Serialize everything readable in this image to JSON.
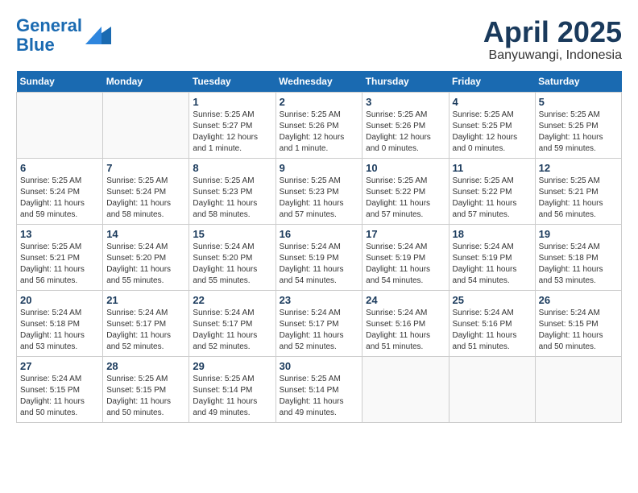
{
  "header": {
    "logo_line1": "General",
    "logo_line2": "Blue",
    "month": "April 2025",
    "location": "Banyuwangi, Indonesia"
  },
  "days_of_week": [
    "Sunday",
    "Monday",
    "Tuesday",
    "Wednesday",
    "Thursday",
    "Friday",
    "Saturday"
  ],
  "weeks": [
    [
      {
        "day": "",
        "content": ""
      },
      {
        "day": "",
        "content": ""
      },
      {
        "day": "1",
        "content": "Sunrise: 5:25 AM\nSunset: 5:27 PM\nDaylight: 12 hours and 1 minute."
      },
      {
        "day": "2",
        "content": "Sunrise: 5:25 AM\nSunset: 5:26 PM\nDaylight: 12 hours and 1 minute."
      },
      {
        "day": "3",
        "content": "Sunrise: 5:25 AM\nSunset: 5:26 PM\nDaylight: 12 hours and 0 minutes."
      },
      {
        "day": "4",
        "content": "Sunrise: 5:25 AM\nSunset: 5:25 PM\nDaylight: 12 hours and 0 minutes."
      },
      {
        "day": "5",
        "content": "Sunrise: 5:25 AM\nSunset: 5:25 PM\nDaylight: 11 hours and 59 minutes."
      }
    ],
    [
      {
        "day": "6",
        "content": "Sunrise: 5:25 AM\nSunset: 5:24 PM\nDaylight: 11 hours and 59 minutes."
      },
      {
        "day": "7",
        "content": "Sunrise: 5:25 AM\nSunset: 5:24 PM\nDaylight: 11 hours and 58 minutes."
      },
      {
        "day": "8",
        "content": "Sunrise: 5:25 AM\nSunset: 5:23 PM\nDaylight: 11 hours and 58 minutes."
      },
      {
        "day": "9",
        "content": "Sunrise: 5:25 AM\nSunset: 5:23 PM\nDaylight: 11 hours and 57 minutes."
      },
      {
        "day": "10",
        "content": "Sunrise: 5:25 AM\nSunset: 5:22 PM\nDaylight: 11 hours and 57 minutes."
      },
      {
        "day": "11",
        "content": "Sunrise: 5:25 AM\nSunset: 5:22 PM\nDaylight: 11 hours and 57 minutes."
      },
      {
        "day": "12",
        "content": "Sunrise: 5:25 AM\nSunset: 5:21 PM\nDaylight: 11 hours and 56 minutes."
      }
    ],
    [
      {
        "day": "13",
        "content": "Sunrise: 5:25 AM\nSunset: 5:21 PM\nDaylight: 11 hours and 56 minutes."
      },
      {
        "day": "14",
        "content": "Sunrise: 5:24 AM\nSunset: 5:20 PM\nDaylight: 11 hours and 55 minutes."
      },
      {
        "day": "15",
        "content": "Sunrise: 5:24 AM\nSunset: 5:20 PM\nDaylight: 11 hours and 55 minutes."
      },
      {
        "day": "16",
        "content": "Sunrise: 5:24 AM\nSunset: 5:19 PM\nDaylight: 11 hours and 54 minutes."
      },
      {
        "day": "17",
        "content": "Sunrise: 5:24 AM\nSunset: 5:19 PM\nDaylight: 11 hours and 54 minutes."
      },
      {
        "day": "18",
        "content": "Sunrise: 5:24 AM\nSunset: 5:19 PM\nDaylight: 11 hours and 54 minutes."
      },
      {
        "day": "19",
        "content": "Sunrise: 5:24 AM\nSunset: 5:18 PM\nDaylight: 11 hours and 53 minutes."
      }
    ],
    [
      {
        "day": "20",
        "content": "Sunrise: 5:24 AM\nSunset: 5:18 PM\nDaylight: 11 hours and 53 minutes."
      },
      {
        "day": "21",
        "content": "Sunrise: 5:24 AM\nSunset: 5:17 PM\nDaylight: 11 hours and 52 minutes."
      },
      {
        "day": "22",
        "content": "Sunrise: 5:24 AM\nSunset: 5:17 PM\nDaylight: 11 hours and 52 minutes."
      },
      {
        "day": "23",
        "content": "Sunrise: 5:24 AM\nSunset: 5:17 PM\nDaylight: 11 hours and 52 minutes."
      },
      {
        "day": "24",
        "content": "Sunrise: 5:24 AM\nSunset: 5:16 PM\nDaylight: 11 hours and 51 minutes."
      },
      {
        "day": "25",
        "content": "Sunrise: 5:24 AM\nSunset: 5:16 PM\nDaylight: 11 hours and 51 minutes."
      },
      {
        "day": "26",
        "content": "Sunrise: 5:24 AM\nSunset: 5:15 PM\nDaylight: 11 hours and 50 minutes."
      }
    ],
    [
      {
        "day": "27",
        "content": "Sunrise: 5:24 AM\nSunset: 5:15 PM\nDaylight: 11 hours and 50 minutes."
      },
      {
        "day": "28",
        "content": "Sunrise: 5:25 AM\nSunset: 5:15 PM\nDaylight: 11 hours and 50 minutes."
      },
      {
        "day": "29",
        "content": "Sunrise: 5:25 AM\nSunset: 5:14 PM\nDaylight: 11 hours and 49 minutes."
      },
      {
        "day": "30",
        "content": "Sunrise: 5:25 AM\nSunset: 5:14 PM\nDaylight: 11 hours and 49 minutes."
      },
      {
        "day": "",
        "content": ""
      },
      {
        "day": "",
        "content": ""
      },
      {
        "day": "",
        "content": ""
      }
    ]
  ]
}
